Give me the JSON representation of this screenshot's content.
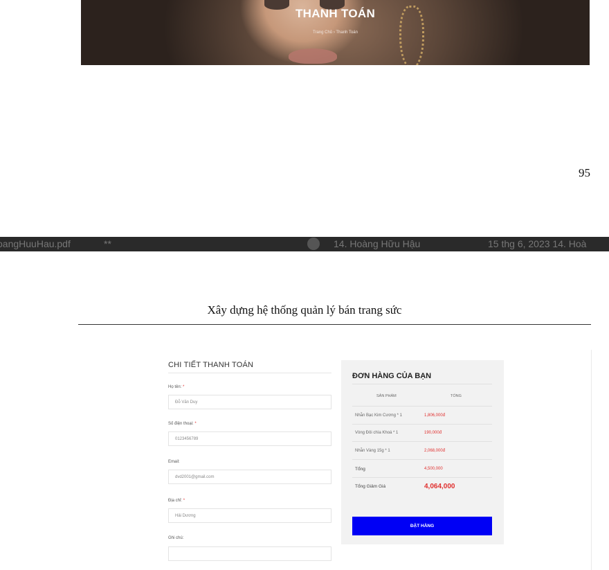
{
  "hero": {
    "title": "THANH TOÁN",
    "breadcrumb": [
      "Trang Chủ",
      "Thanh Toán"
    ],
    "breadcrumb_sep": "›"
  },
  "page_number": "95",
  "viewer": {
    "file_name": "oangHuuHau.pdf",
    "dots": "**",
    "author": "14. Hoàng Hữu Hậu",
    "date": "15 thg 6, 2023 14. Hoà"
  },
  "document": {
    "title": "Xây dựng hệ thống quản lý bán trang sức"
  },
  "billing": {
    "title": "CHI TIẾT THANH TOÁN",
    "required_mark": "*",
    "fields": [
      {
        "label": "Họ tên:",
        "value": "Đỗ Văn Duy"
      },
      {
        "label": "Số điện thoại:",
        "value": "0123456789"
      },
      {
        "label": "Email:",
        "value": "dvd2001@gmail.com"
      },
      {
        "label": "Địa chỉ:",
        "value": "Hải Dương"
      },
      {
        "label": "Ghi chú:",
        "value": ""
      }
    ]
  },
  "order": {
    "title": "ĐƠN HÀNG CỦA BẠN",
    "col_product": "SẢN PHẨM",
    "col_total": "TỔNG",
    "items": [
      {
        "name": "Nhẫn Bạc Kim Cương * 1",
        "price": "1,806,000đ"
      },
      {
        "name": "Vòng Đôi chìa Khoá * 1",
        "price": "190,000đ"
      },
      {
        "name": "Nhẫn Vàng 15g * 1",
        "price": "2,068,000đ"
      }
    ],
    "subtotal_label": "Tổng",
    "subtotal_value": "4,500,000",
    "discount_label": "Tổng Giảm Giá",
    "discount_value": "4,064,000",
    "button": "ĐẶT HÀNG"
  }
}
